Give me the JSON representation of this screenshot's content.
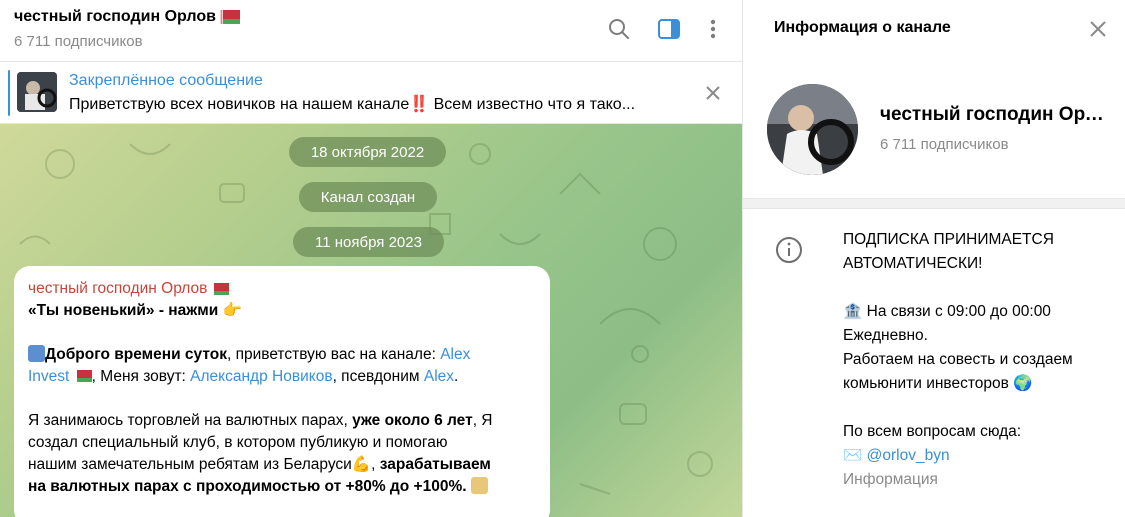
{
  "chat": {
    "title": "честный господин Орлов",
    "subscribers": "6 711 подписчиков",
    "flag_icon": "belarus-flag",
    "header_icons": [
      "search-icon",
      "sidebar-toggle-icon",
      "more-vertical-icon"
    ],
    "accent": "#3a8fd8"
  },
  "pinned": {
    "label": "Закреплённое сообщение",
    "text": "Приветствую всех новичков на нашем канале‼️  Всем известно что я тако..."
  },
  "service": {
    "date1": "18 октября 2022",
    "created": "Канал создан",
    "date2": "11 ноября 2023"
  },
  "message": {
    "author": "честный господин Орлов",
    "line1": "«Ты новенький» - нажми",
    "p2_bold": "Доброго времени суток",
    "p2_a": ", приветствую вас на канале: ",
    "p2_link1a": "Alex",
    "p2_link1b": "Invest",
    "p2_b": ", Меня зовут: ",
    "p2_link2": "Александр Новиков",
    "p2_c": ", псевдоним ",
    "p2_link3": "Alex",
    "p2_d": ".",
    "p3_a": "Я занимаюсь торговлей на валютных парах, ",
    "p3_bold1": "уже около 6 лет",
    "p3_b": ", Я",
    "p3_line2": "создал специальный клуб, в котором публикую и помогаю",
    "p3_line3": "нашим замечательным ребятам из Беларуси",
    "p3_bold2": "зарабатываем",
    "p3_line4": "на валютных парах с проходимостью от +80% до +100%."
  },
  "info": {
    "title": "Информация о канале",
    "name": "честный господин Орлов",
    "subscribers": "6 711 подписчиков",
    "desc1": "ПОДПИСКА ПРИНИМАЕТСЯ",
    "desc2": "АВТОМАТИЧЕСКИ!",
    "desc3": "На связи с 09:00 до 00:00",
    "desc4": "Ежедневно.",
    "desc5": "Работаем на совесть и создаем",
    "desc6": "комьюнити инвесторов",
    "desc7": "По всем вопросам сюда:",
    "contact": "@orlov_byn",
    "caption": "Информация"
  }
}
